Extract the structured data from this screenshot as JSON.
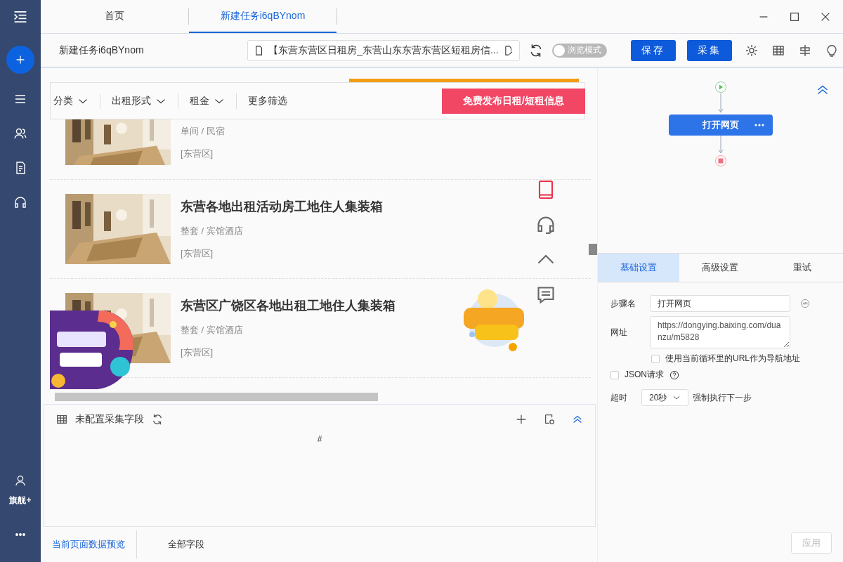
{
  "sidebar": {
    "user_label": "旗舰+"
  },
  "tabs": [
    {
      "label": "首页",
      "selected": false
    },
    {
      "label": "新建任务i6qBYnom",
      "selected": true
    }
  ],
  "toolbar": {
    "task_name": "新建任务i6qBYnom",
    "url": "【东营东营区日租房_东营山东东营东营区短租房信...",
    "browse_mode": {
      "label": "浏览模式",
      "on": false
    },
    "buttons": [
      "保存",
      "采集"
    ]
  },
  "browser": {
    "filters": [
      {
        "label": "分类",
        "dropdown": true
      },
      {
        "label": "出租形式",
        "dropdown": true
      },
      {
        "label": "租金",
        "dropdown": true
      },
      {
        "label": "更多筛选",
        "dropdown": false
      }
    ],
    "publish_button": "免费发布日租/短租信息",
    "listings": [
      {
        "type": "单间 / 民宿",
        "district": "[东营区]"
      },
      {
        "title": "东营各地出租活动房工地住人集装箱",
        "type": "整套 / 宾馆酒店",
        "district": "[东营区]"
      },
      {
        "title": "东营区广饶区各地出租工地住人集装箱",
        "type": "整套 / 宾馆酒店",
        "district": "[东营区]"
      }
    ]
  },
  "flow": {
    "step": "打开网页"
  },
  "settings_tabs": [
    {
      "label": "基础设置",
      "selected": true
    },
    {
      "label": "高级设置",
      "selected": false
    },
    {
      "label": "重试",
      "selected": false
    }
  ],
  "form": {
    "step_name": {
      "label": "步骤名",
      "value": "打开网页"
    },
    "url": {
      "label": "网址",
      "value": "https://dongying.baixing.com/duanzu/m5828"
    },
    "loop_url": {
      "label": "使用当前循环里的URL作为导航地址",
      "checked": false
    },
    "json_request": {
      "label": "JSON请求",
      "checked": false
    },
    "timeout": {
      "label": "超时",
      "value": "20秒",
      "suffix": "强制执行下一步"
    }
  },
  "fields_panel": {
    "title": "未配置采集字段",
    "column": "#"
  },
  "bottom_tabs": [
    {
      "label": "当前页面数据预览",
      "selected": true
    },
    {
      "label": "全部字段",
      "selected": false
    }
  ],
  "apply_button": {
    "label": "应用",
    "disabled": true
  }
}
